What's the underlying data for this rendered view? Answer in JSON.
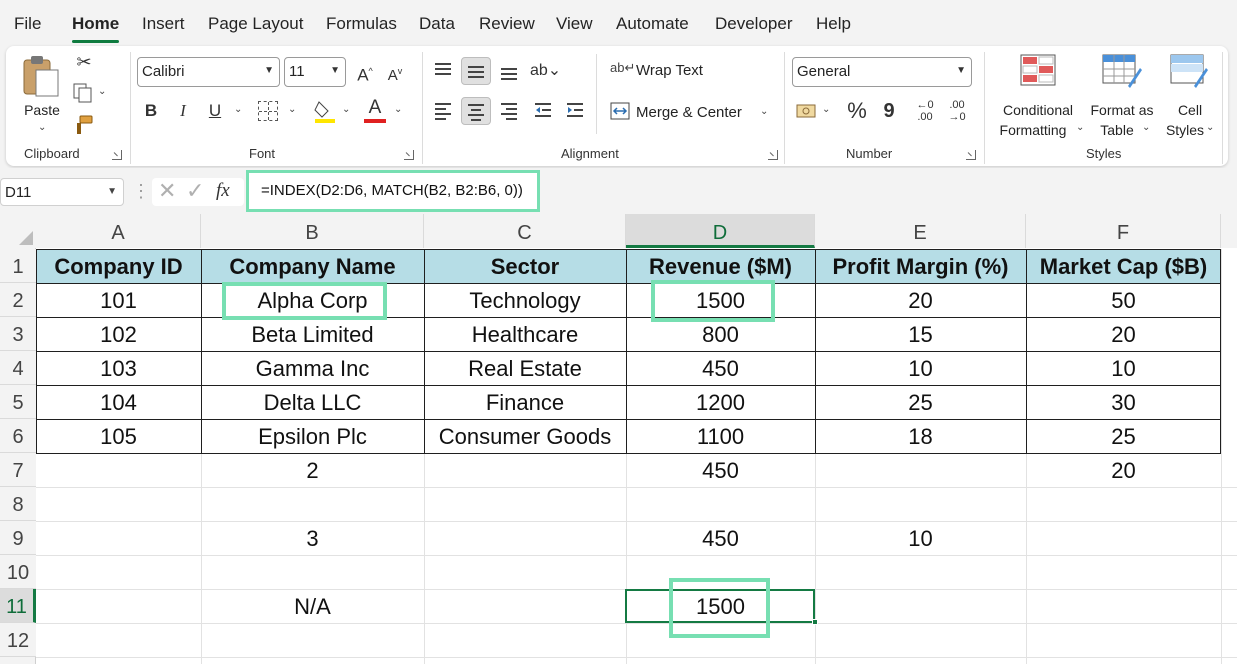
{
  "menu": {
    "tabs": [
      "File",
      "Home",
      "Insert",
      "Page Layout",
      "Formulas",
      "Data",
      "Review",
      "View",
      "Automate",
      "Developer",
      "Help"
    ],
    "active_tab": "Home"
  },
  "ribbon": {
    "clipboard": {
      "paste_label": "Paste",
      "group_label": "Clipboard"
    },
    "font": {
      "font_name": "Calibri",
      "font_size": "11",
      "bold": "B",
      "italic": "I",
      "underline": "U",
      "group_label": "Font",
      "font_color": "#e02020",
      "fill_color": "#ffe600"
    },
    "alignment": {
      "wrap_text": "Wrap Text",
      "merge_center": "Merge & Center",
      "group_label": "Alignment"
    },
    "number": {
      "format": "General",
      "percent": "%",
      "comma": "9",
      "group_label": "Number"
    },
    "styles": {
      "conditional_line1": "Conditional",
      "conditional_line2": "Formatting",
      "format_table_line1": "Format as",
      "format_table_line2": "Table",
      "cell_styles_line1": "Cell",
      "cell_styles_line2": "Styles",
      "group_label": "Styles"
    }
  },
  "formula_bar": {
    "name_box": "D11",
    "fx": "fx",
    "formula": "=INDEX(D2:D6, MATCH(B2, B2:B6, 0))"
  },
  "sheet": {
    "columns": [
      "A",
      "B",
      "C",
      "D",
      "E",
      "F"
    ],
    "active_column": "D",
    "rows": [
      "1",
      "2",
      "3",
      "4",
      "5",
      "6",
      "7",
      "8",
      "9",
      "10",
      "11",
      "12"
    ],
    "active_row": "11",
    "header": [
      "Company ID",
      "Company Name",
      "Sector",
      "Revenue ($M)",
      "Profit Margin (%)",
      "Market Cap ($B)"
    ],
    "data": [
      [
        "101",
        "Alpha Corp",
        "Technology",
        "1500",
        "20",
        "50"
      ],
      [
        "102",
        "Beta Limited",
        "Healthcare",
        "800",
        "15",
        "20"
      ],
      [
        "103",
        "Gamma Inc",
        "Real Estate",
        "450",
        "10",
        "10"
      ],
      [
        "104",
        "Delta LLC",
        "Finance",
        "1200",
        "25",
        "30"
      ],
      [
        "105",
        "Epsilon Plc",
        "Consumer Goods",
        "1100",
        "18",
        "25"
      ]
    ],
    "row7": {
      "B": "2",
      "D": "450",
      "F": "20"
    },
    "row9": {
      "B": "3",
      "D": "450",
      "E": "10"
    },
    "row11": {
      "B": "N/A",
      "D": "1500"
    },
    "table_header_color": "#b6dde6",
    "highlight_color": "#77dfb2",
    "selection_color": "#147a43"
  }
}
